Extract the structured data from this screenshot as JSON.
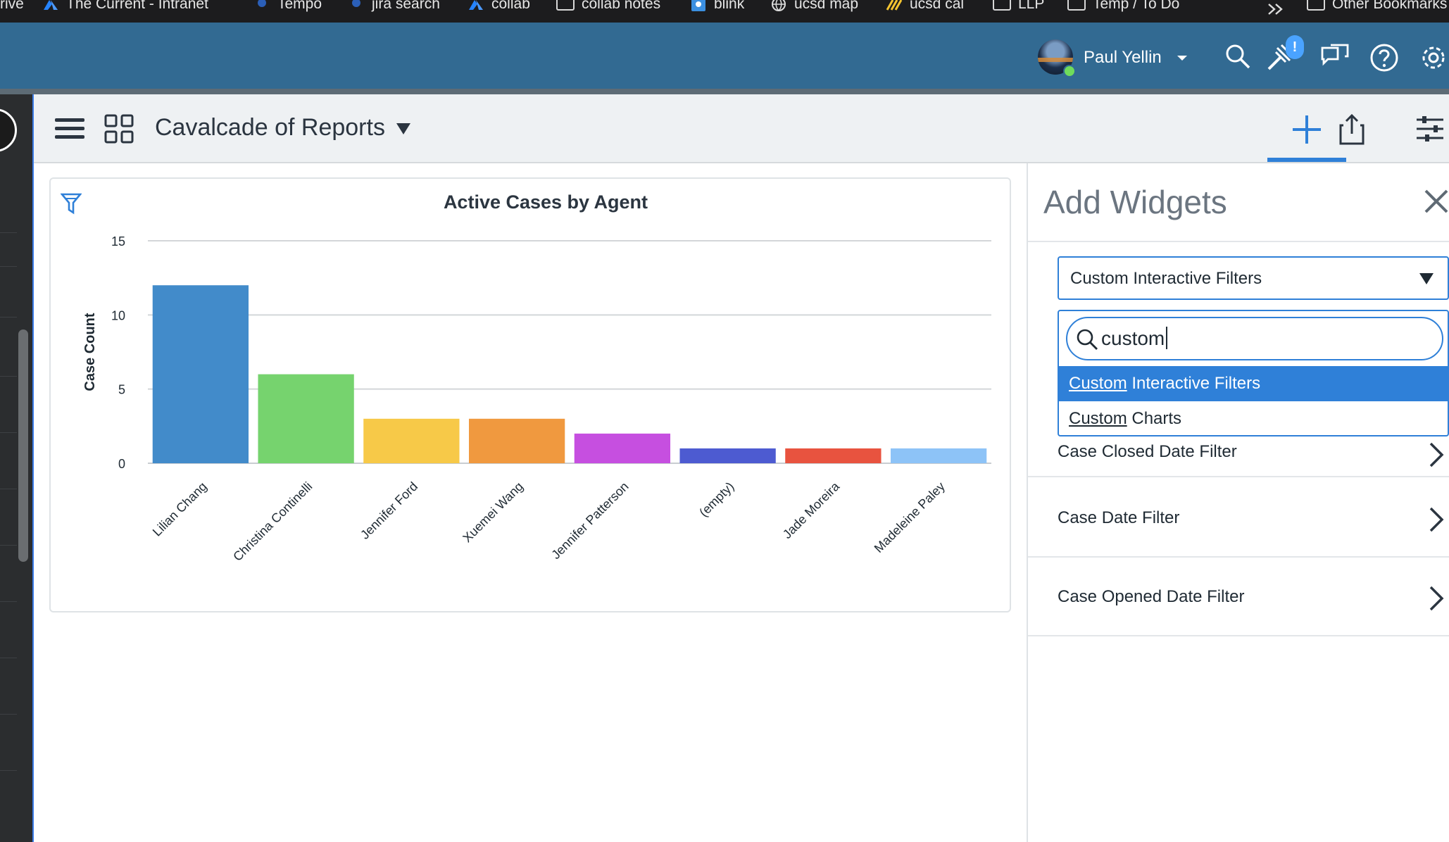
{
  "bookmarks": [
    {
      "label": "rive"
    },
    {
      "label": "The Current - Intranet"
    },
    {
      "label": "Tempo"
    },
    {
      "label": "jira search"
    },
    {
      "label": "collab"
    },
    {
      "label": "collab notes"
    },
    {
      "label": "blink"
    },
    {
      "label": "ucsd map"
    },
    {
      "label": "ucsd cal"
    },
    {
      "label": "LLP"
    },
    {
      "label": "Temp / To Do"
    },
    {
      "label": "Other Bookmarks"
    }
  ],
  "header": {
    "user_name": "Paul Yellin",
    "badge": "!"
  },
  "toolbar": {
    "dashboard_title": "Cavalcade of Reports"
  },
  "chart_data": {
    "type": "bar",
    "title": "Active Cases by Agent",
    "ylabel": "Case Count",
    "xlabel": "",
    "ylim": [
      0,
      15
    ],
    "yticks": [
      0,
      5,
      10,
      15
    ],
    "categories": [
      "Lilian Chang",
      "Christina Continelli",
      "Jennifer Ford",
      "Xuemei Wang",
      "Jennifer Patterson",
      "(empty)",
      "Jade Moreira",
      "Madeleine Paley"
    ],
    "values": [
      12,
      6,
      3,
      3,
      2,
      1,
      1,
      1
    ],
    "colors": [
      "#428bca",
      "#76d36e",
      "#f7c948",
      "#f0993f",
      "#c64fe0",
      "#4d5bd1",
      "#e8533f",
      "#8dc3f7"
    ]
  },
  "panel": {
    "title": "Add Widgets",
    "select_value": "Custom Interactive Filters",
    "search_value": "custom",
    "options": [
      {
        "match": "Custom",
        "rest": " Interactive Filters",
        "selected": true
      },
      {
        "match": "Custom",
        "rest": " Charts",
        "selected": false
      }
    ],
    "hidden_row": "Case Closed Date Filter",
    "rows": [
      "Case Date Filter",
      "Case Opened Date Filter"
    ]
  }
}
